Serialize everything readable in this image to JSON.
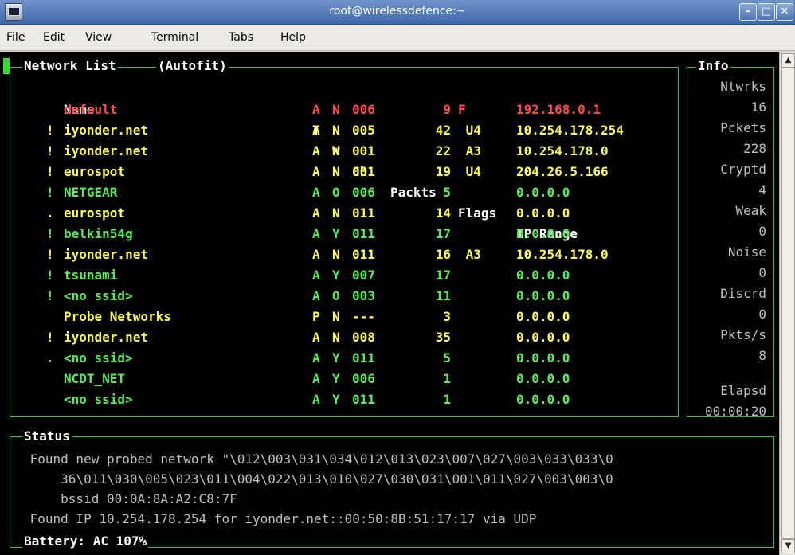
{
  "window": {
    "title": "root@wirelessdefence:~"
  },
  "menu": [
    {
      "label": "File"
    },
    {
      "label": "Edit"
    },
    {
      "label": "View"
    },
    {
      "label": "Terminal"
    },
    {
      "label": "Tabs"
    },
    {
      "label": "Help"
    }
  ],
  "network_list": {
    "title": "Network List",
    "mode": "(Autofit)",
    "headers": {
      "name": "Name",
      "t": "T",
      "w": "W",
      "ch": "Ch",
      "packets": "Packts",
      "flags": "Flags",
      "ip": "IP Range"
    },
    "rows": [
      {
        "mark": " ",
        "name": "default",
        "t": "A",
        "w": "N",
        "ch": "006",
        "packets": "9",
        "flags": "F",
        "ip": "192.168.0.1",
        "color": "#ff4a4a"
      },
      {
        "mark": "!",
        "name": "iyonder.net",
        "t": "A",
        "w": "N",
        "ch": "005",
        "packets": "42",
        "flags": " U4",
        "ip": "10.254.178.254",
        "color": "#ffff4a"
      },
      {
        "mark": "!",
        "name": "iyonder.net",
        "t": "A",
        "w": "N",
        "ch": "001",
        "packets": "22",
        "flags": " A3",
        "ip": "10.254.178.0",
        "color": "#ffff4a"
      },
      {
        "mark": "!",
        "name": "eurospot",
        "t": "A",
        "w": "N",
        "ch": "001",
        "packets": "19",
        "flags": " U4",
        "ip": "204.26.5.166",
        "color": "#ffff4a"
      },
      {
        "mark": "!",
        "name": "NETGEAR",
        "t": "A",
        "w": "O",
        "ch": "006",
        "packets": "5",
        "flags": "",
        "ip": "0.0.0.0",
        "color": "#55ee55"
      },
      {
        "mark": ".",
        "name": "eurospot",
        "t": "A",
        "w": "N",
        "ch": "011",
        "packets": "14",
        "flags": "",
        "ip": "0.0.0.0",
        "color": "#ffff4a"
      },
      {
        "mark": "!",
        "name": "belkin54g",
        "t": "A",
        "w": "Y",
        "ch": "011",
        "packets": "17",
        "flags": "",
        "ip": "0.0.0.0",
        "color": "#55ee55"
      },
      {
        "mark": "!",
        "name": "iyonder.net",
        "t": "A",
        "w": "N",
        "ch": "011",
        "packets": "16",
        "flags": " A3",
        "ip": "10.254.178.0",
        "color": "#ffff4a"
      },
      {
        "mark": "!",
        "name": "tsunami",
        "t": "A",
        "w": "Y",
        "ch": "007",
        "packets": "17",
        "flags": "",
        "ip": "0.0.0.0",
        "color": "#55ee55"
      },
      {
        "mark": "!",
        "name": "<no ssid>",
        "t": "A",
        "w": "O",
        "ch": "003",
        "packets": "11",
        "flags": "",
        "ip": "0.0.0.0",
        "color": "#55ee55"
      },
      {
        "mark": " ",
        "name": "Probe Networks",
        "t": "P",
        "w": "N",
        "ch": "---",
        "packets": "3",
        "flags": "",
        "ip": "0.0.0.0",
        "color": "#ffff4a"
      },
      {
        "mark": "!",
        "name": "iyonder.net",
        "t": "A",
        "w": "N",
        "ch": "008",
        "packets": "35",
        "flags": "",
        "ip": "0.0.0.0",
        "color": "#ffff4a"
      },
      {
        "mark": ".",
        "name": "<no ssid>",
        "t": "A",
        "w": "Y",
        "ch": "011",
        "packets": "5",
        "flags": "",
        "ip": "0.0.0.0",
        "color": "#55ee55"
      },
      {
        "mark": " ",
        "name": "NCDT_NET",
        "t": "A",
        "w": "Y",
        "ch": "006",
        "packets": "1",
        "flags": "",
        "ip": "0.0.0.0",
        "color": "#55ee55"
      },
      {
        "mark": " ",
        "name": "<no ssid>",
        "t": "A",
        "w": "Y",
        "ch": "011",
        "packets": "1",
        "flags": "",
        "ip": "0.0.0.0",
        "color": "#55ee55"
      }
    ]
  },
  "info": {
    "title": "Info",
    "items": [
      {
        "label": "Ntwrks",
        "value": "16"
      },
      {
        "label": "Pckets",
        "value": "228"
      },
      {
        "label": "Cryptd",
        "value": "4"
      },
      {
        "label": "Weak",
        "value": "0"
      },
      {
        "label": "Noise",
        "value": "0"
      },
      {
        "label": "Discrd",
        "value": "0"
      },
      {
        "label": "Pkts/s",
        "value": "8"
      },
      {
        "label": "",
        "value": ""
      },
      {
        "label": "Elapsd",
        "value": "00:00:20"
      }
    ]
  },
  "status": {
    "title": "Status",
    "lines": [
      " Found new probed network \"\\012\\003\\031\\034\\012\\013\\023\\007\\027\\003\\033\\033\\0",
      "     36\\011\\030\\005\\023\\011\\004\\022\\013\\010\\027\\030\\031\\001\\011\\027\\003\\003\\0",
      "     bssid 00:0A:8A:A2:C8:7F",
      " Found IP 10.254.178.254 for iyonder.net::00:50:8B:51:17:17 via UDP"
    ],
    "battery": "Battery: AC 107%"
  }
}
